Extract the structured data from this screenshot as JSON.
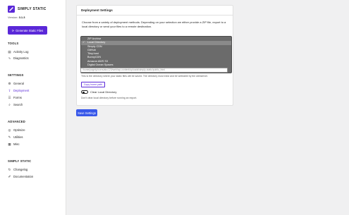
{
  "brand": {
    "name": "SIMPLY STATIC",
    "version_label": "Version:",
    "version": "3.1.3"
  },
  "generate_button": "Generate Static Files",
  "sections": {
    "tools": "TOOLS",
    "settings": "SETTINGS",
    "advanced": "ADVANCED",
    "simply_static": "SIMPLY STATIC"
  },
  "tools": [
    {
      "label": "Activity Log",
      "icon": "chart-icon"
    },
    {
      "label": "Diagnostics",
      "icon": "pulse-icon"
    }
  ],
  "settings": [
    {
      "label": "General",
      "icon": "gear-icon"
    },
    {
      "label": "Deployment",
      "icon": "migrate-icon"
    },
    {
      "label": "Forms",
      "icon": "forms-icon"
    },
    {
      "label": "Search",
      "icon": "search-icon"
    }
  ],
  "advanced": [
    {
      "label": "Optimize",
      "icon": "optimize-icon"
    },
    {
      "label": "Utilities",
      "icon": "wrench-icon"
    },
    {
      "label": "Misc",
      "icon": "grid-icon"
    }
  ],
  "simply_static": [
    {
      "label": "Changelog",
      "icon": "update-icon"
    },
    {
      "label": "Documentation",
      "icon": "edit-icon"
    }
  ],
  "panel": {
    "title": "Deployment Settings",
    "description": "Choose from a variety of deployment methods. Depending on your selection we either provide a ZIP file, export to a local directory or send your files to a remote destination."
  },
  "deploy_options": [
    "ZIP Archive",
    "Local Directory",
    "Simply CDN",
    "GitHub",
    "Tiiny.host",
    "BunnyCDN",
    "Amazon AWS S3",
    "Digital Ocean Spaces"
  ],
  "deploy_selected": "Local Directory",
  "local_dir": {
    "path": "/home/pagely/users/abc123/web/wp-content/uploads/simply-static/public_html",
    "help": "This is the directory where your static files will be saved. The directory must exist and be writeable by the webserver.",
    "copy_button": "Copy home path",
    "toggle_label": "Clear Local Directory",
    "toggle_help": "Don't clear local directory before running an export."
  },
  "save_button": "Save Settings",
  "colors": {
    "accent": "#5a28d8",
    "primary_button": "#3858e9",
    "dropdown_bg": "#6b6b6b"
  }
}
